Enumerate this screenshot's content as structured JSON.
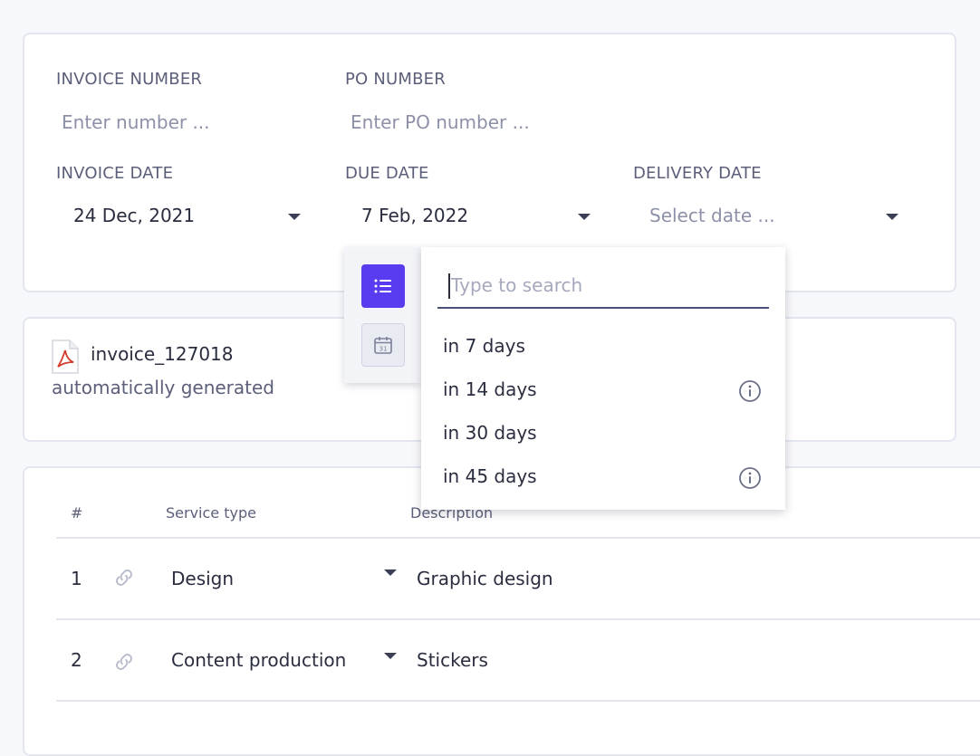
{
  "form": {
    "invoice_number_label": "INVOICE NUMBER",
    "invoice_number_placeholder": "Enter number ...",
    "po_number_label": "PO NUMBER",
    "po_number_placeholder": "Enter PO number ...",
    "invoice_date_label": "INVOICE DATE",
    "invoice_date_value": "24 Dec, 2021",
    "due_date_label": "DUE DATE",
    "due_date_value": "7 Feb, 2022",
    "delivery_date_label": "DELIVERY DATE",
    "delivery_date_placeholder": "Select date ..."
  },
  "file": {
    "name": "invoice_127018",
    "subtitle": "automatically generated",
    "icon": "pdf-file-icon"
  },
  "dropdown": {
    "search_placeholder": "Type to search",
    "options": [
      {
        "label": "in 7 days",
        "info": false
      },
      {
        "label": "in 14 days",
        "info": true
      },
      {
        "label": "in 30 days",
        "info": false
      },
      {
        "label": "in 45 days",
        "info": true
      }
    ],
    "accent_color": "#5a3cf0",
    "calendar_day": "31"
  },
  "table": {
    "headers": {
      "index": "#",
      "service": "Service type",
      "description": "Description"
    },
    "rows": [
      {
        "index": "1",
        "service": "Design",
        "description": "Graphic design"
      },
      {
        "index": "2",
        "service": "Content production",
        "description": "Stickers"
      }
    ]
  }
}
